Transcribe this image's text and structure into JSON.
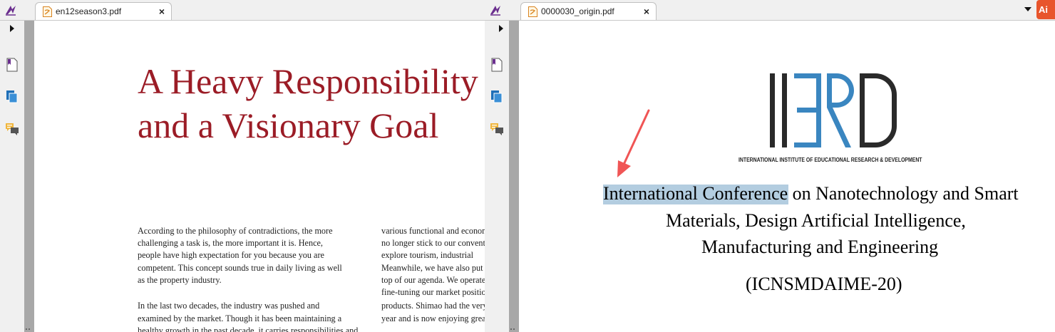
{
  "left": {
    "tab_title": "en12season3.pdf",
    "tab_close": "×",
    "doc_title": [
      "A Heavy Responsibility",
      "and a Visionary Goal"
    ],
    "col1": [
      "According to the philosophy of contradictions, the more",
      "challenging a task is, the more important it is. Hence,",
      "people have high expectation for you because you are",
      "competent. This concept sounds true in daily living as well",
      "as the property industry.",
      "",
      "In the last two decades, the industry was pushed and",
      "examined by the market. Though it has been maintaining a",
      "healthy growth in the past decade, it carries responsibilities and"
    ],
    "col2": [
      "various functional and economic",
      "no longer stick to our conventional",
      "explore tourism, industrial",
      "Meanwhile, we have also put",
      "top of our agenda. We operate",
      "fine-tuning our market position",
      "products. Shimao had the very",
      "year and is now enjoying great",
      ""
    ]
  },
  "right": {
    "tab_title": "0000030_origin.pdf",
    "tab_close": "×",
    "logo_subtitle": "INTERNATIONAL INSTITUTE OF EDUCATIONAL RESEARCH & DEVELOPMENT",
    "conference_lines": [
      "International Conference on Nanotechnology and Smart",
      "Materials, Design Artificial Intelligence,",
      "Manufacturing and Engineering"
    ],
    "conference_code": "(ICNSMDAIME-20)",
    "highlighted_text": "International Confere",
    "corner_badge": "Ai"
  },
  "colors": {
    "title_red": "#9b1c26",
    "highlight": "#b3cde0",
    "arrow": "#f05555",
    "logo_blue": "#3a86c0",
    "logo_dark": "#2a2a2a",
    "accent_orange": "#e8552c"
  }
}
